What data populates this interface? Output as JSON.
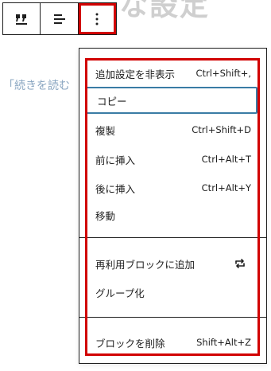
{
  "toolbar": {
    "buttons": [
      {
        "name": "quote-icon",
        "glyph": "quote"
      },
      {
        "name": "align-icon",
        "glyph": "align"
      },
      {
        "name": "more-options-icon",
        "glyph": "dots"
      }
    ]
  },
  "background": {
    "heading_partial": "な設定",
    "side_text": "「続きを読む"
  },
  "menu": {
    "group1": [
      {
        "label": "追加設定を非表示",
        "shortcut": "Ctrl+Shift+,"
      },
      {
        "label": "コピー",
        "shortcut": ""
      },
      {
        "label": "複製",
        "shortcut": "Ctrl+Shift+D"
      },
      {
        "label": "前に挿入",
        "shortcut": "Ctrl+Alt+T"
      },
      {
        "label": "後に挿入",
        "shortcut": "Ctrl+Alt+Y"
      },
      {
        "label": "移動",
        "shortcut": ""
      }
    ],
    "group2": [
      {
        "label": "再利用ブロックに追加",
        "icon": "reusable-icon"
      },
      {
        "label": "グループ化"
      }
    ],
    "group3": [
      {
        "label": "ブロックを削除",
        "shortcut": "Shift+Alt+Z"
      }
    ]
  },
  "colors": {
    "highlight": "#d10000",
    "focus": "#3a7ca5",
    "link_text": "#8aa6c1"
  }
}
